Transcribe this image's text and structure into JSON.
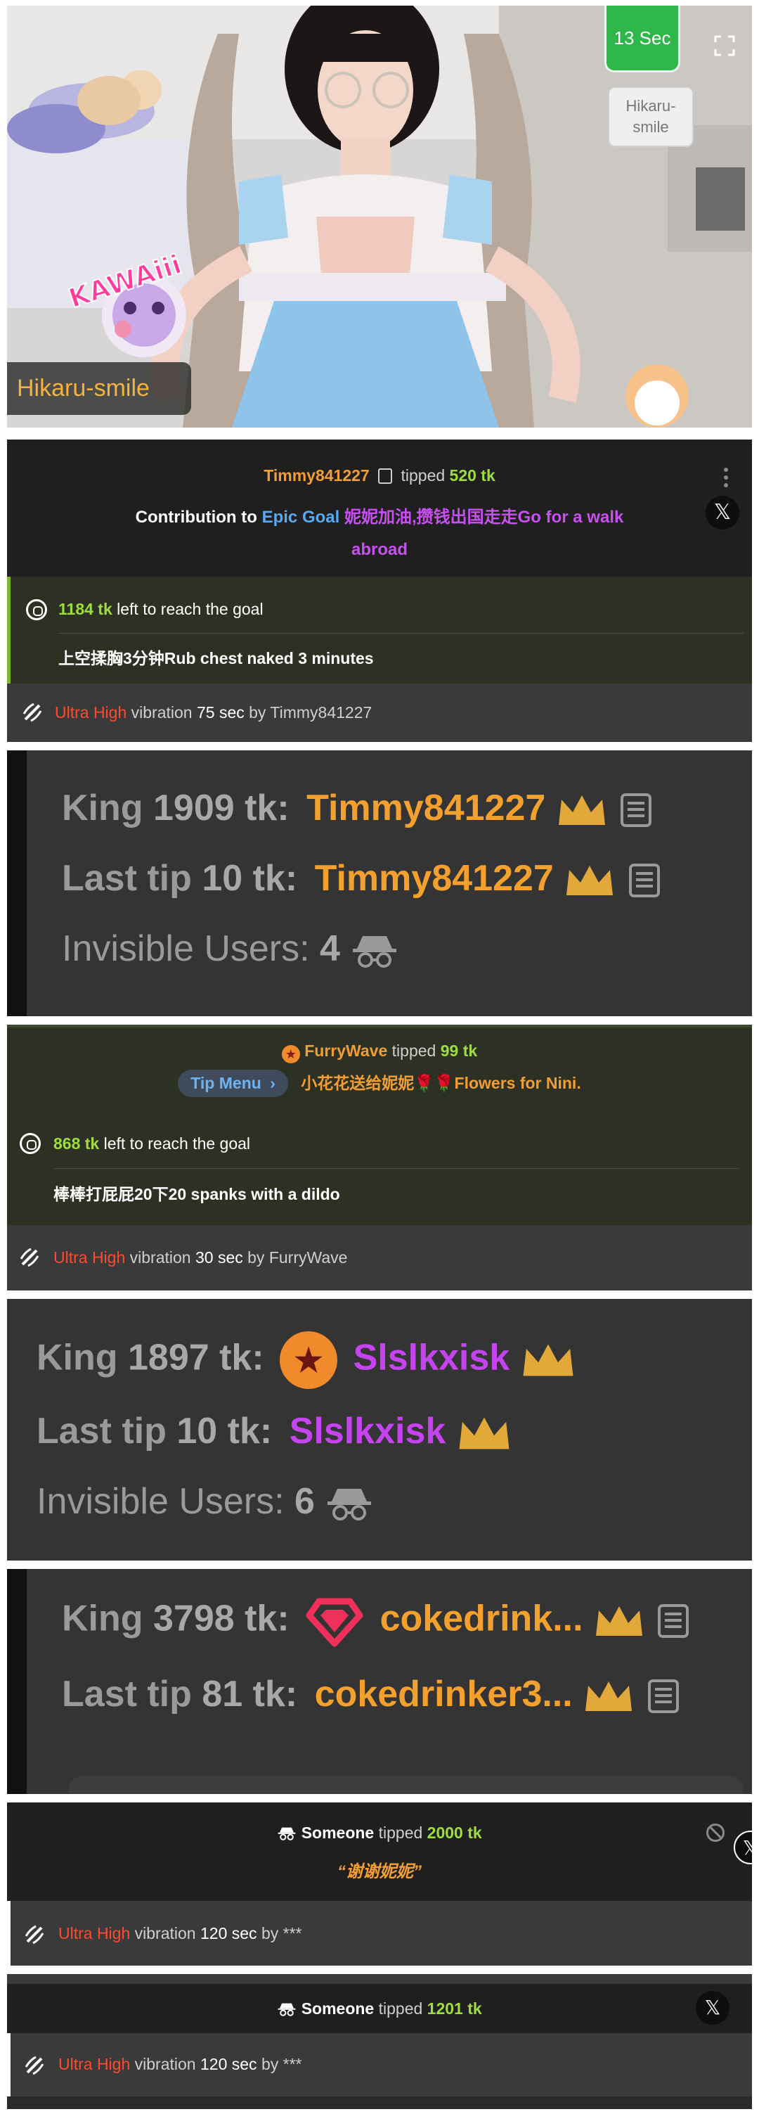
{
  "video": {
    "timer": "13 Sec",
    "model_badge": "Hikaru-smile",
    "model_name": "Hikaru-smile",
    "kawaii_text": "KAWAiii"
  },
  "tip1": {
    "tipper": "Timmy841227",
    "tipped_word": "tipped",
    "amount": "520 tk",
    "contribution_prefix": "Contribution to",
    "goal_label": "Epic Goal",
    "goal_message_line1": "妮妮加油,攒钱出国走走Go for a walk",
    "goal_message_line2": "abroad",
    "remaining": "1184 tk",
    "remaining_suffix": "left to reach the goal",
    "goal_text": "上空揉胸3分钟Rub chest naked 3 minutes",
    "vibration_level": "Ultra High",
    "vibration_text": "vibration",
    "vibration_duration": "75 sec",
    "by": "by",
    "vibration_user": "Timmy841227"
  },
  "stats1": {
    "king_label": "King",
    "king_amount": "1909 tk:",
    "king_user": "Timmy841227",
    "last_tip_label": "Last tip",
    "last_tip_amount": "10 tk:",
    "last_tip_user": "Timmy841227",
    "invisible_label": "Invisible Users:",
    "invisible_count": "4"
  },
  "tip2": {
    "tipper": "FurryWave",
    "tipped_word": "tipped",
    "amount": "99 tk",
    "menu_label": "Tip Menu",
    "menu_item": "小花花送给妮妮🌹🌹Flowers for Nini.",
    "remaining": "868 tk",
    "remaining_suffix": "left to reach the goal",
    "goal_text": "棒棒打屁屁20下20 spanks with a dildo",
    "vibration_level": "Ultra High",
    "vibration_text": "vibration",
    "vibration_duration": "30 sec",
    "by": "by",
    "vibration_user": "FurryWave"
  },
  "stats2": {
    "king_label": "King",
    "king_amount": "1897 tk:",
    "king_user": "Slslkxisk",
    "last_tip_label": "Last tip",
    "last_tip_amount": "10 tk:",
    "last_tip_user": "Slslkxisk",
    "invisible_label": "Invisible Users:",
    "invisible_count": "6"
  },
  "stats3": {
    "king_label": "King",
    "king_amount": "3798 tk:",
    "king_user": "cokedrink...",
    "last_tip_label": "Last tip",
    "last_tip_amount": "81 tk:",
    "last_tip_user": "cokedrinker3..."
  },
  "tip3": {
    "tipper": "Someone",
    "tipped_word": "tipped",
    "amount": "2000 tk",
    "message": "“谢谢妮妮”",
    "vibration_level": "Ultra High",
    "vibration_text": "vibration",
    "vibration_duration": "120 sec",
    "by": "by",
    "vibration_user": "***"
  },
  "tip4": {
    "tipper": "Someone",
    "tipped_word": "tipped",
    "amount": "1201 tk",
    "vibration_level": "Ultra High",
    "vibration_text": "vibration",
    "vibration_duration": "120 sec",
    "by": "by",
    "vibration_user": "***"
  },
  "colors": {
    "green_accent": "#9fdc3f",
    "orange_accent": "#f29d35",
    "red_vibration": "#ff4a2f",
    "purple_name": "#c643f0",
    "panel_bg": "#2e2e2e"
  }
}
